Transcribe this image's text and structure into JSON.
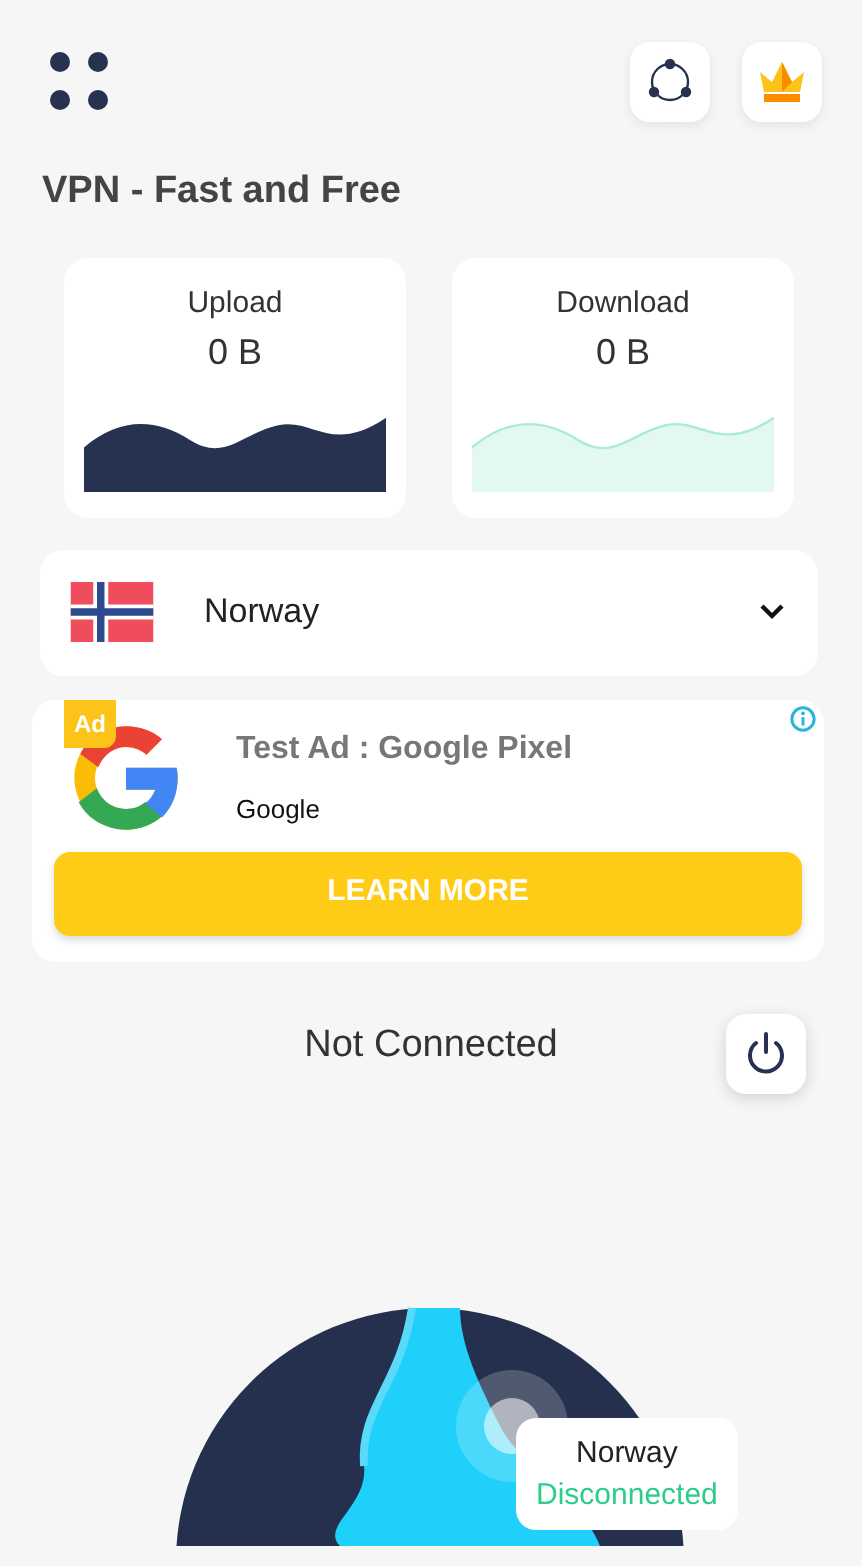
{
  "title": "VPN - Fast and Free",
  "stats": [
    {
      "label": "Upload",
      "value": "0 B",
      "kind": "upload"
    },
    {
      "label": "Download",
      "value": "0 B",
      "kind": "download"
    }
  ],
  "country": {
    "name": "Norway"
  },
  "ad": {
    "badge": "Ad",
    "headline": "Test Ad : Google Pixel",
    "advertiser": "Google",
    "button": "LEARN MORE"
  },
  "status": "Not Connected",
  "tooltip": {
    "country": "Norway",
    "status": "Disconnected"
  }
}
